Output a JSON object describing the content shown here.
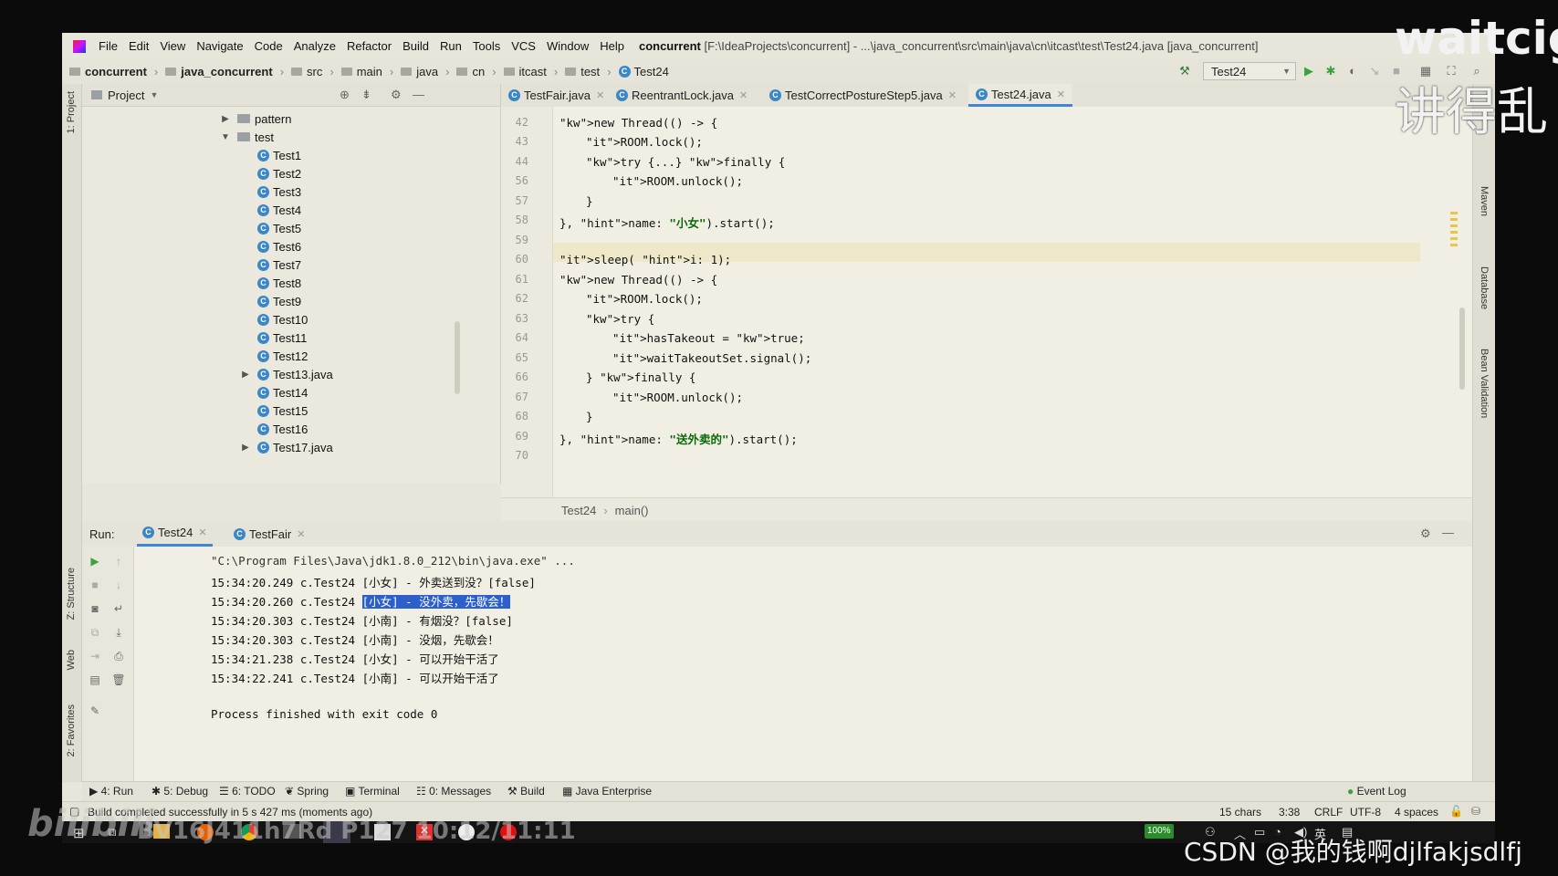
{
  "menu": {
    "items": [
      "File",
      "Edit",
      "View",
      "Navigate",
      "Code",
      "Analyze",
      "Refactor",
      "Build",
      "Run",
      "Tools",
      "VCS",
      "Window",
      "Help"
    ],
    "project_name": "concurrent",
    "project_path": "[F:\\IdeaProjects\\concurrent] - ...\\java_concurrent\\src\\main\\java\\cn\\itcast\\test\\Test24.java [java_concurrent]"
  },
  "breadcrumb": [
    "concurrent",
    "java_concurrent",
    "src",
    "main",
    "java",
    "cn",
    "itcast",
    "test",
    "Test24"
  ],
  "run_config": "Test24",
  "project_panel": {
    "title": "Project",
    "tree": [
      {
        "label": "pattern",
        "type": "folder",
        "expanded": false
      },
      {
        "label": "test",
        "type": "folder",
        "expanded": true
      },
      {
        "label": "Test1",
        "type": "class"
      },
      {
        "label": "Test2",
        "type": "class"
      },
      {
        "label": "Test3",
        "type": "class"
      },
      {
        "label": "Test4",
        "type": "class"
      },
      {
        "label": "Test5",
        "type": "class"
      },
      {
        "label": "Test6",
        "type": "class"
      },
      {
        "label": "Test7",
        "type": "class"
      },
      {
        "label": "Test8",
        "type": "class"
      },
      {
        "label": "Test9",
        "type": "class"
      },
      {
        "label": "Test10",
        "type": "class"
      },
      {
        "label": "Test11",
        "type": "class"
      },
      {
        "label": "Test12",
        "type": "class"
      },
      {
        "label": "Test13.java",
        "type": "class",
        "expandable": true
      },
      {
        "label": "Test14",
        "type": "class"
      },
      {
        "label": "Test15",
        "type": "class"
      },
      {
        "label": "Test16",
        "type": "class"
      },
      {
        "label": "Test17.java",
        "type": "class",
        "expandable": true
      }
    ]
  },
  "editor_tabs": [
    {
      "label": "TestFair.java",
      "active": false
    },
    {
      "label": "ReentrantLock.java",
      "active": false
    },
    {
      "label": "TestCorrectPostureStep5.java",
      "active": false
    },
    {
      "label": "Test24.java",
      "active": true
    }
  ],
  "editor": {
    "lines": [
      {
        "n": "42",
        "code": "new Thread(() -> {"
      },
      {
        "n": "43",
        "code": "ROOM.lock();"
      },
      {
        "n": "44",
        "code": "try {...} finally {"
      },
      {
        "n": "56",
        "code": "ROOM.unlock();"
      },
      {
        "n": "57",
        "code": "}"
      },
      {
        "n": "58",
        "code": "}, name: \"小女\").start();"
      },
      {
        "n": "59",
        "code": ""
      },
      {
        "n": "60",
        "code": "sleep( i: 1);"
      },
      {
        "n": "61",
        "code": "new Thread(() -> {"
      },
      {
        "n": "62",
        "code": "ROOM.lock();"
      },
      {
        "n": "63",
        "code": "try {"
      },
      {
        "n": "64",
        "code": "hasTakeout = true;"
      },
      {
        "n": "65",
        "code": "waitTakeoutSet.signal();"
      },
      {
        "n": "66",
        "code": "} finally {"
      },
      {
        "n": "67",
        "code": "ROOM.unlock();"
      },
      {
        "n": "68",
        "code": "}"
      },
      {
        "n": "69",
        "code": "}, name: \"送外卖的\").start();"
      },
      {
        "n": "70",
        "code": ""
      }
    ],
    "breadcrumb_class": "Test24",
    "breadcrumb_method": "main()"
  },
  "run": {
    "label": "Run:",
    "tabs": [
      "Test24",
      "TestFair"
    ],
    "output": [
      "\"C:\\Program Files\\Java\\jdk1.8.0_212\\bin\\java.exe\" ...",
      "15:34:20.249 c.Test24 [小女] - 外卖送到没？[false]",
      "15:34:20.260 c.Test24 [小女] - 没外卖，先歇会！",
      "15:34:20.303 c.Test24 [小南] - 有烟没？[false]",
      "15:34:20.303 c.Test24 [小南] - 没烟，先歇会！",
      "15:34:21.238 c.Test24 [小女] - 可以开始干活了",
      "15:34:22.241 c.Test24 [小南] - 可以开始干活了",
      "",
      "Process finished with exit code 0"
    ],
    "selected_prefix": "15:34:20.260 c.Test24 ",
    "selected_text": "[小女] - 没外卖，先歇会！"
  },
  "bottom_tools": [
    "4: Run",
    "5: Debug",
    "6: TODO",
    "Spring",
    "Terminal",
    "0: Messages",
    "Build",
    "Java Enterprise",
    "Event Log"
  ],
  "status": {
    "message": "Build completed successfully in 5 s 427 ms (moments ago)",
    "chars": "15 chars",
    "position": "3:38",
    "line_sep": "CRLF",
    "encoding": "UTF-8",
    "indent": "4 spaces"
  },
  "side_tools": {
    "left": [
      "1: Project",
      "Z: Structure",
      "Web",
      "2: Favorites"
    ],
    "right": [
      "Maven",
      "Database",
      "Bean Validation"
    ]
  },
  "taskbar": {
    "battery": "100%",
    "ime": "英"
  },
  "overlays": {
    "top_right_1": "waitcig",
    "top_right_2": "讲得乱",
    "bilibili": "bilibili",
    "video_id": "BV16J411h7Rd P127 10:12/11:11",
    "csdn": "CSDN @我的钱啊djlfakjsdlfj"
  },
  "colors": {
    "selection": "#2d5fcc",
    "tab_active": "#3f86d6",
    "class_icon": "#3a87c8"
  }
}
